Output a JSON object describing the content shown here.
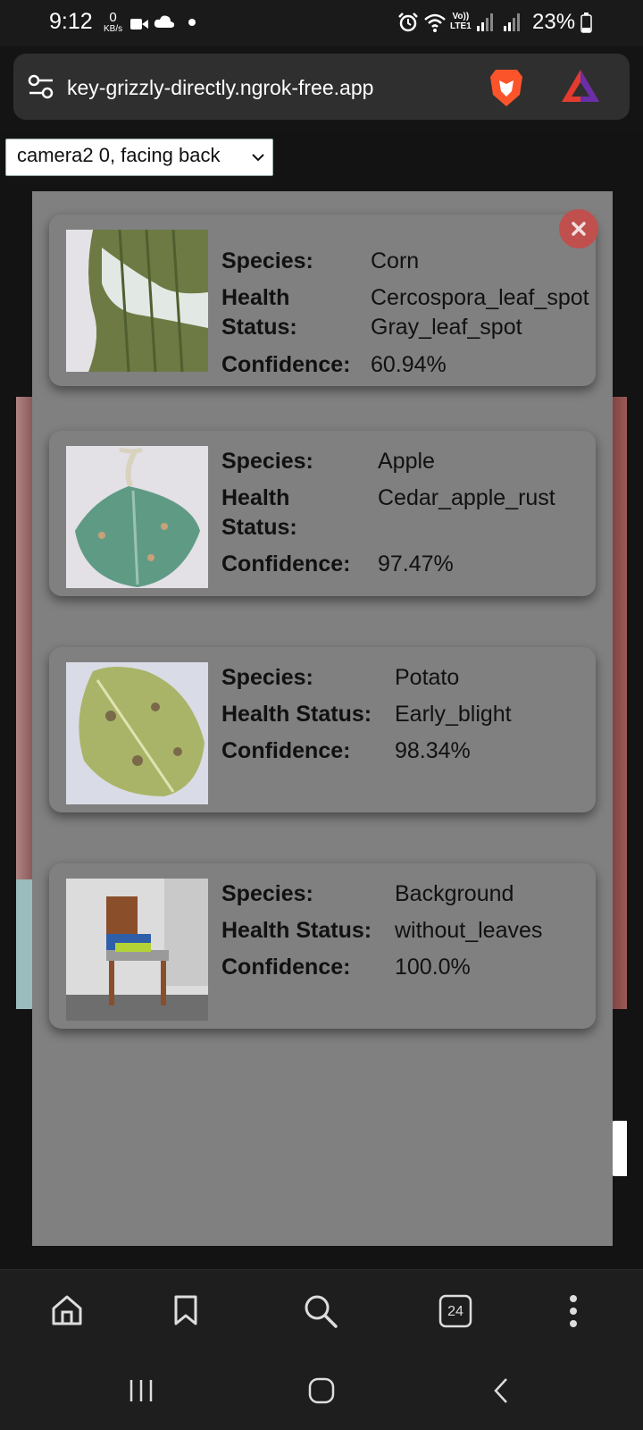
{
  "status_bar": {
    "time": "9:12",
    "net_speed_value": "0",
    "net_speed_unit": "KB/s",
    "network_label_top": "Vo))",
    "network_label_bottom": "LTE1",
    "battery": "23%"
  },
  "browser": {
    "url": "key-grizzly-directly.ngrok-free.app",
    "tab_count": "24"
  },
  "camera_select": {
    "selected": "camera2 0, facing back"
  },
  "results": [
    {
      "species_label": "Species:",
      "species": "Corn",
      "health_label_1": "Health",
      "health_label_2": "Status:",
      "health_1": "Cercospora_leaf_spot",
      "health_2": "Gray_leaf_spot",
      "confidence_label": "Confidence:",
      "confidence": "60.94%"
    },
    {
      "species_label": "Species:",
      "species": "Apple",
      "health_label_1": "Health",
      "health_label_2": "Status:",
      "health_1": "Cedar_apple_rust",
      "confidence_label": "Confidence:",
      "confidence": "97.47%"
    },
    {
      "species_label": "Species:",
      "species": "Potato",
      "health_label": "Health Status:",
      "health": "Early_blight",
      "confidence_label": "Confidence:",
      "confidence": "98.34%"
    },
    {
      "species_label": "Species:",
      "species": "Background",
      "health_label": "Health Status:",
      "health": "without_leaves",
      "confidence_label": "Confidence:",
      "confidence": "100.0%"
    }
  ],
  "colors": {
    "modal": "#808080",
    "close_button": "#c0504d",
    "address_bar": "#2f2f2f"
  }
}
